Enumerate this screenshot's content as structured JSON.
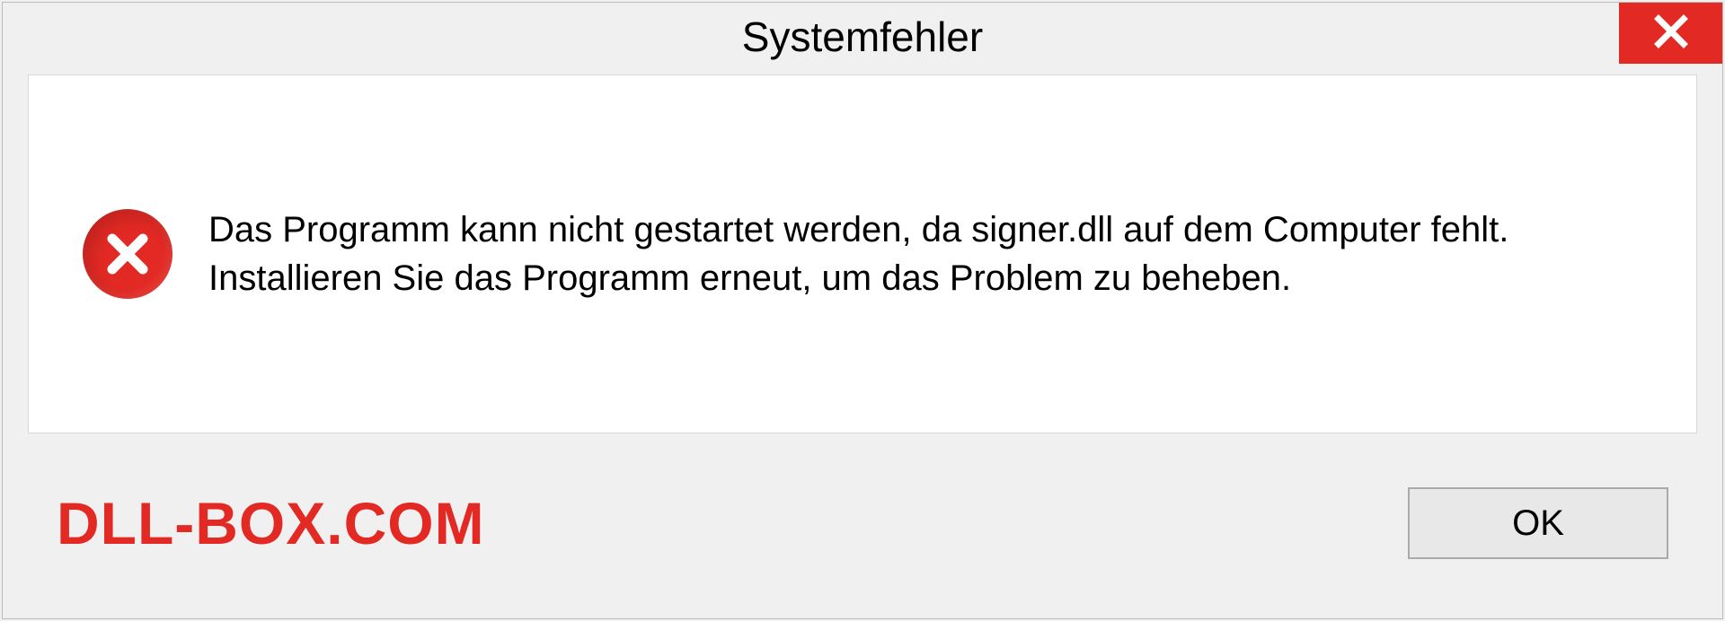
{
  "dialog": {
    "title": "Systemfehler",
    "message": "Das Programm kann nicht gestartet werden, da signer.dll auf dem Computer fehlt. Installieren Sie das Programm erneut, um das Problem zu beheben.",
    "ok_label": "OK",
    "watermark": "DLL-BOX.COM"
  }
}
